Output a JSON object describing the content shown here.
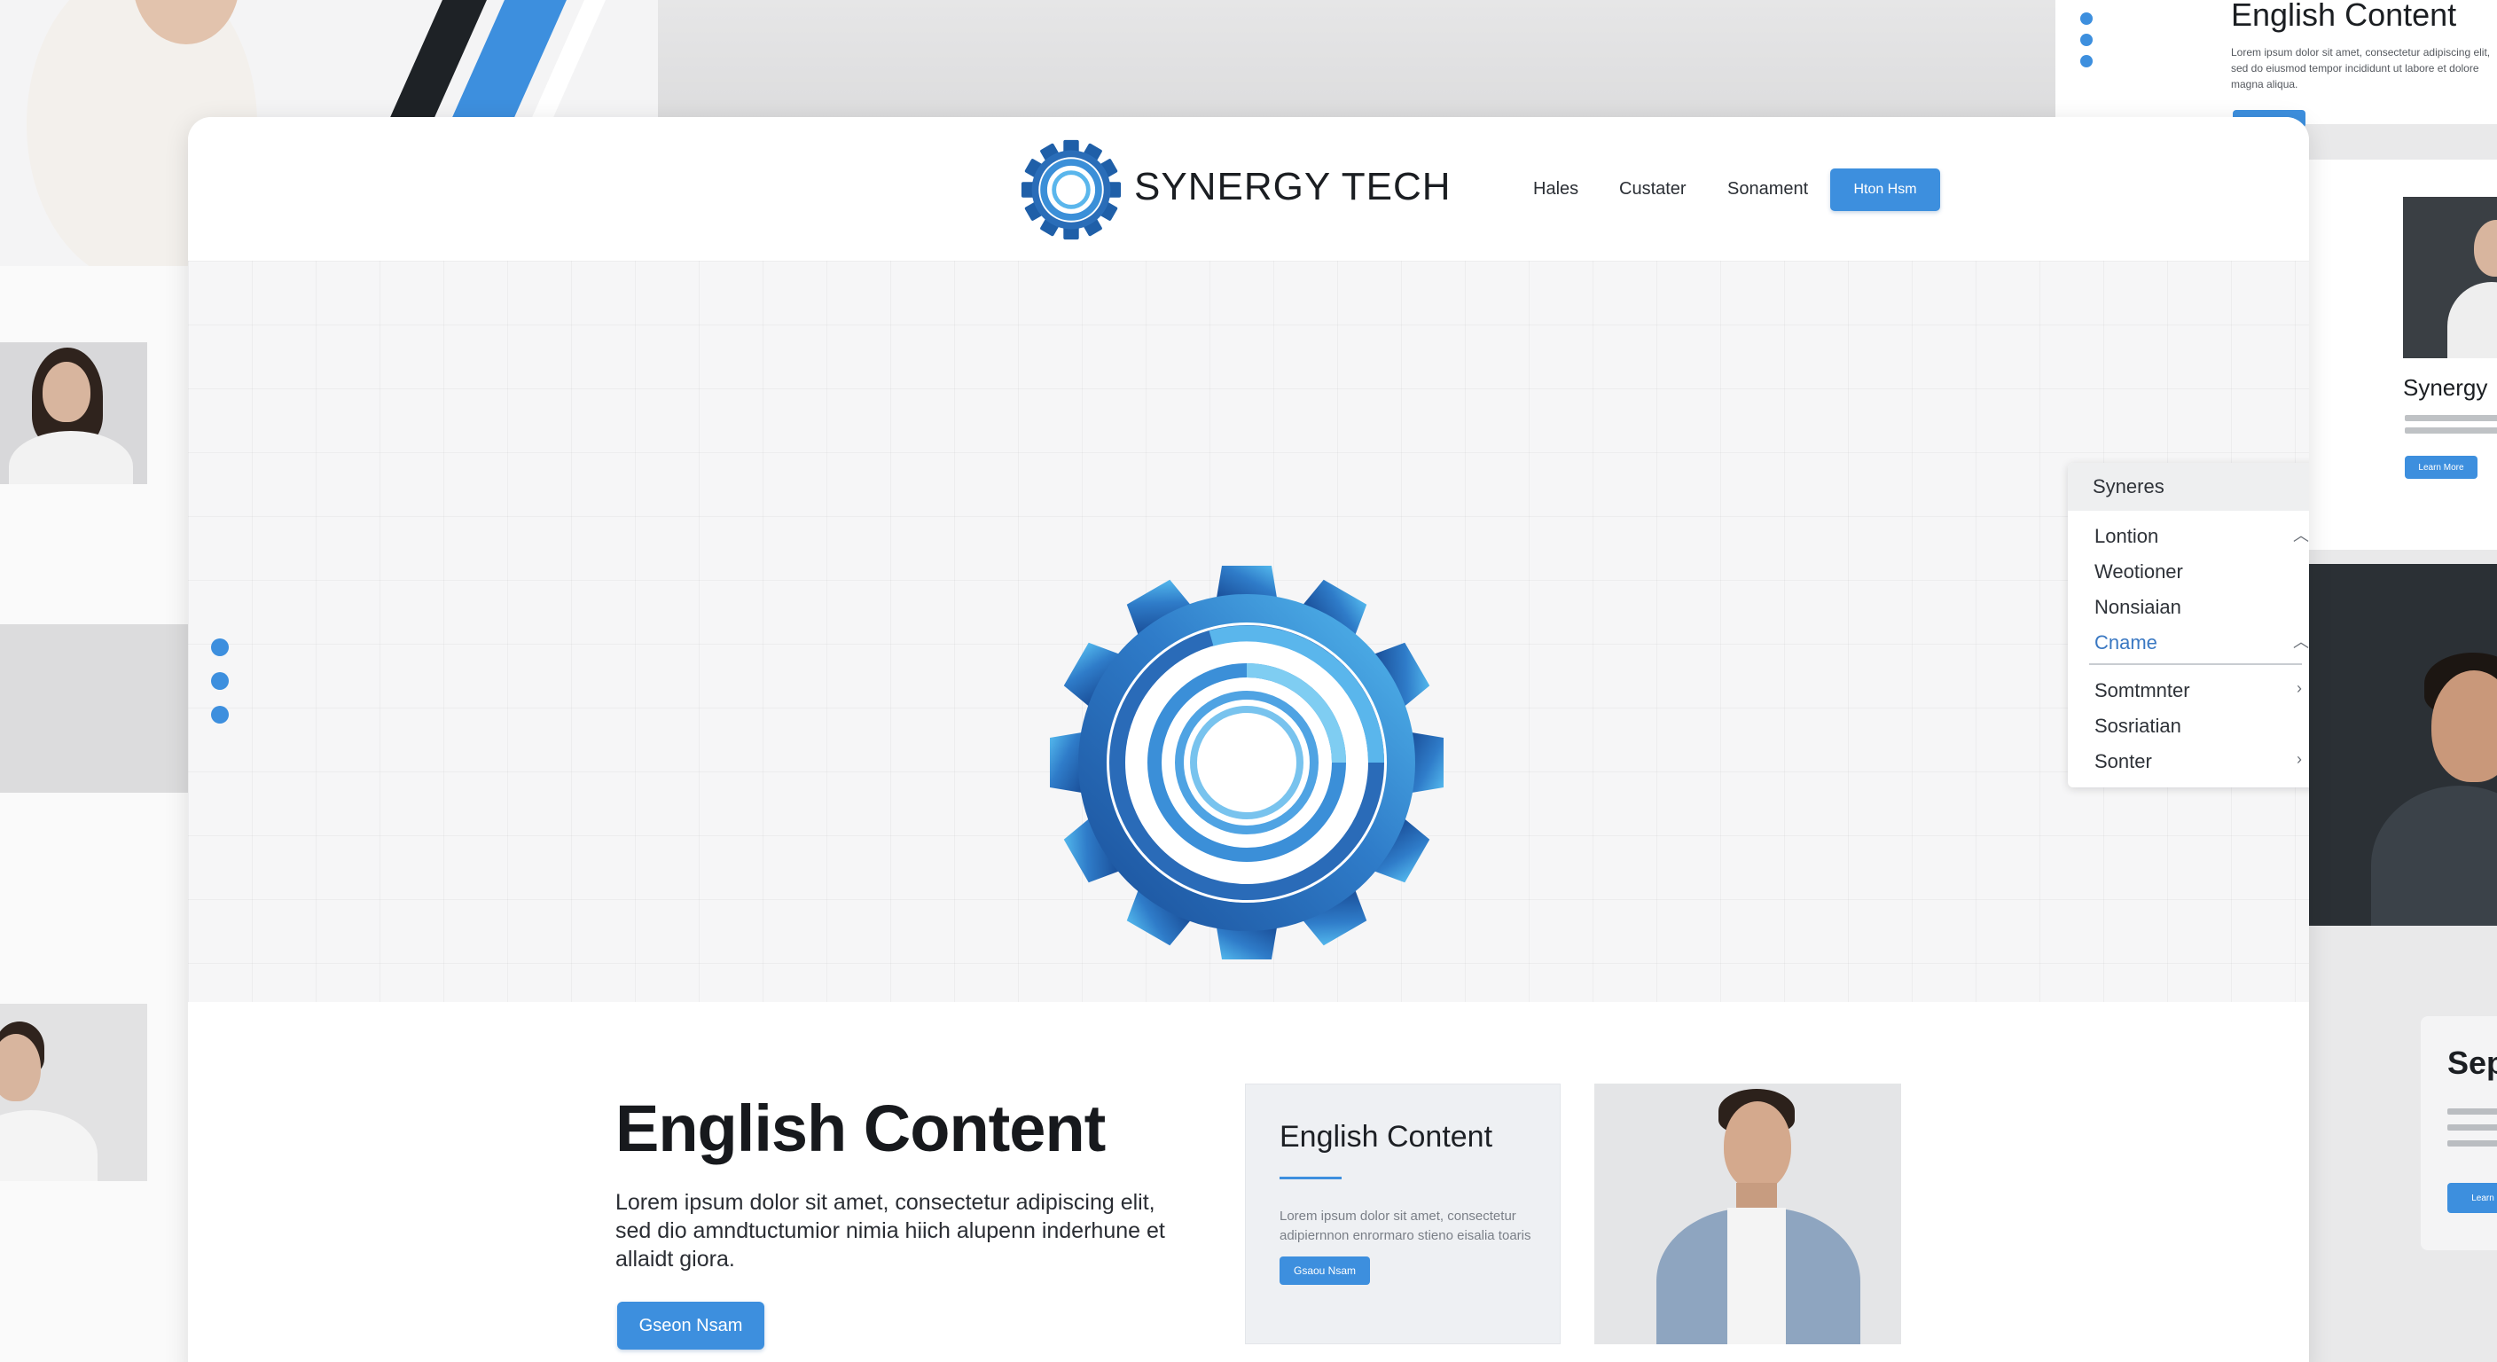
{
  "colors": {
    "accent": "#3d8fde",
    "accent_dark": "#1f5fa8",
    "accent_light": "#5ab6ec",
    "page_bg": "#e9e9ea",
    "hero_bg": "#f6f6f7"
  },
  "background": {
    "top_right_card": {
      "title": "English Content",
      "body": "Lorem ipsum dolor sit amet, consectetur adipiscing elit, sed do eiusmod tempor incididunt ut labore et dolore magna aliqua."
    },
    "right_card": {
      "title": "Synergy",
      "button_label": "Learn More"
    },
    "right_card_lower": {
      "title": "Sep",
      "button_label": "Learn"
    }
  },
  "header": {
    "logo_icon": "gear-icon",
    "brand": "SYNERGY TECH",
    "nav": [
      "Hales",
      "Custater",
      "Sonament"
    ],
    "cta_label": "Hton Hsm"
  },
  "hero": {
    "emblem_icon": "gear-icon",
    "carousel_active_index": 2,
    "carousel_count": 5,
    "side_dots_count": 3
  },
  "dropdown": {
    "header": "Syneres",
    "items": [
      {
        "label": "Lontion",
        "caret": "chevron-up-icon"
      },
      {
        "label": "Weotioner",
        "caret": ""
      },
      {
        "label": "Nonsiaian",
        "caret": ""
      },
      {
        "label": "Cname",
        "caret": "chevron-up-icon"
      },
      {
        "label": "Somtmnter",
        "caret": "chevron-right-icon"
      },
      {
        "label": "Sosriatian",
        "caret": ""
      },
      {
        "label": "Sonter",
        "caret": "chevron-right-icon"
      }
    ]
  },
  "content": {
    "title": "English Content",
    "body": "Lorem ipsum dolor sit amet, consectetur adipiscing elit, sed dio amndtuctumior nimia hiich alupenn inderhune et allaidt giora.",
    "cta_label": "Gseon Nsam",
    "card": {
      "title": "English Content",
      "body": "Lorem ipsum dolor sit amet, consectetur adipiernnon enrormaro stieno eisalia toaris",
      "button_label": "Gsaou Nsam"
    }
  }
}
